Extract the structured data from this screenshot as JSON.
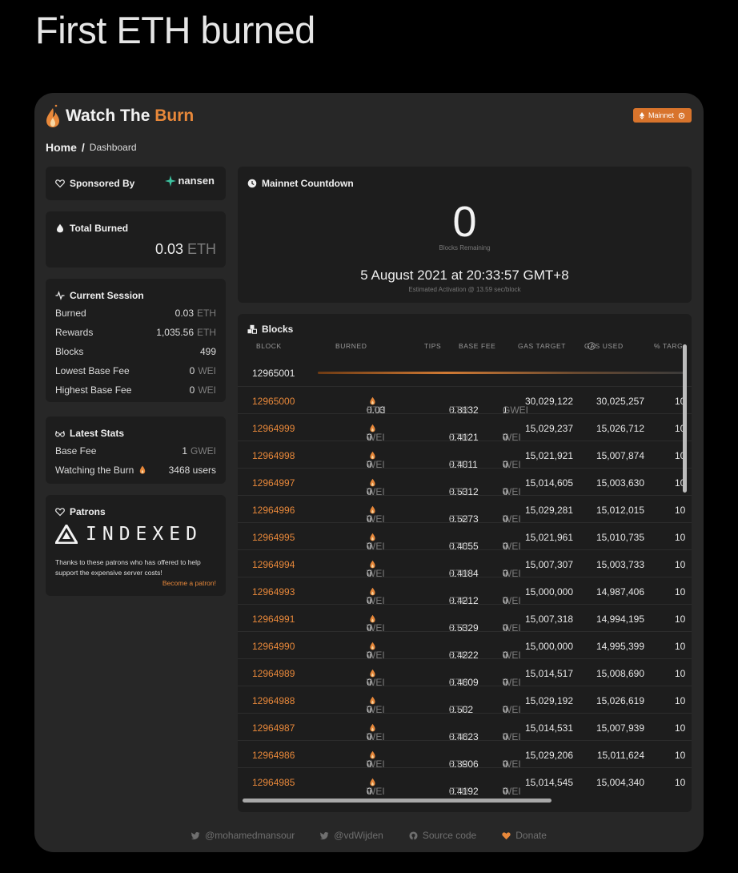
{
  "headline": "First ETH burned",
  "app": {
    "title_main": "Watch The",
    "title_accent": "Burn",
    "network_label": "Mainnet"
  },
  "breadcrumb": {
    "home": "Home",
    "sep": "/",
    "current": "Dashboard"
  },
  "sponsor": {
    "title": "Sponsored By",
    "logo_text": "nansen"
  },
  "total_burned": {
    "title": "Total Burned",
    "value": "0.03",
    "unit": "ETH"
  },
  "session": {
    "title": "Current Session",
    "rows": [
      {
        "label": "Burned",
        "value": "0.03",
        "unit": "ETH"
      },
      {
        "label": "Rewards",
        "value": "1,035.56",
        "unit": "ETH"
      },
      {
        "label": "Blocks",
        "value": "499",
        "unit": ""
      },
      {
        "label": "Lowest Base Fee",
        "value": "0",
        "unit": "WEI"
      },
      {
        "label": "Highest Base Fee",
        "value": "0",
        "unit": "WEI"
      }
    ]
  },
  "latest": {
    "title": "Latest Stats",
    "rows": [
      {
        "label": "Base Fee",
        "value": "1",
        "unit": "GWEI"
      },
      {
        "label": "Watching the Burn",
        "value": "3468 users",
        "unit": ""
      }
    ]
  },
  "patrons": {
    "title": "Patrons",
    "logo_text": "INDEXED",
    "note": "Thanks to these patrons who has offered to help support the expensive server costs!",
    "link": "Become a patron!"
  },
  "countdown": {
    "title": "Mainnet Countdown",
    "value": "0",
    "sub": "Blocks Remaining",
    "date": "5 August 2021 at 20:33:57 GMT+8",
    "estimate": "Estimated Activation @ 13.59 sec/block"
  },
  "blocks": {
    "title": "Blocks",
    "headers": [
      "BLOCK",
      "BURNED",
      "TIPS",
      "BASE FEE",
      "GAS TARGET",
      "GAS USED",
      "% TARG"
    ],
    "pending_block": "12965001",
    "rows": [
      {
        "block": "12965000",
        "burned": "0.03",
        "burned_unit": "ETH",
        "tips": "0.8132",
        "tips_unit": "ETH",
        "base": "1",
        "base_unit": "GWEI",
        "target": "30,029,122",
        "used": "30,025,257",
        "pct": "10"
      },
      {
        "block": "12964999",
        "burned": "0",
        "burned_unit": "WEI",
        "tips": "0.4121",
        "tips_unit": "ETH",
        "base": "0",
        "base_unit": "WEI",
        "target": "15,029,237",
        "used": "15,026,712",
        "pct": "10"
      },
      {
        "block": "12964998",
        "burned": "0",
        "burned_unit": "WEI",
        "tips": "0.4011",
        "tips_unit": "ETH",
        "base": "0",
        "base_unit": "WEI",
        "target": "15,021,921",
        "used": "15,007,874",
        "pct": "10"
      },
      {
        "block": "12964997",
        "burned": "0",
        "burned_unit": "WEI",
        "tips": "0.5312",
        "tips_unit": "ETH",
        "base": "0",
        "base_unit": "WEI",
        "target": "15,014,605",
        "used": "15,003,630",
        "pct": "10"
      },
      {
        "block": "12964996",
        "burned": "0",
        "burned_unit": "WEI",
        "tips": "0.5273",
        "tips_unit": "ETH",
        "base": "0",
        "base_unit": "WEI",
        "target": "15,029,281",
        "used": "15,012,015",
        "pct": "10"
      },
      {
        "block": "12964995",
        "burned": "0",
        "burned_unit": "WEI",
        "tips": "0.4055",
        "tips_unit": "ETH",
        "base": "0",
        "base_unit": "WEI",
        "target": "15,021,961",
        "used": "15,010,735",
        "pct": "10"
      },
      {
        "block": "12964994",
        "burned": "0",
        "burned_unit": "WEI",
        "tips": "0.4184",
        "tips_unit": "ETH",
        "base": "0",
        "base_unit": "WEI",
        "target": "15,007,307",
        "used": "15,003,733",
        "pct": "10"
      },
      {
        "block": "12964993",
        "burned": "0",
        "burned_unit": "WEI",
        "tips": "0.4212",
        "tips_unit": "ETH",
        "base": "0",
        "base_unit": "WEI",
        "target": "15,000,000",
        "used": "14,987,406",
        "pct": "10"
      },
      {
        "block": "12964991",
        "burned": "0",
        "burned_unit": "WEI",
        "tips": "0.5329",
        "tips_unit": "ETH",
        "base": "0",
        "base_unit": "WEI",
        "target": "15,007,318",
        "used": "14,994,195",
        "pct": "10"
      },
      {
        "block": "12964990",
        "burned": "0",
        "burned_unit": "WEI",
        "tips": "0.4222",
        "tips_unit": "ETH",
        "base": "0",
        "base_unit": "WEI",
        "target": "15,000,000",
        "used": "14,995,399",
        "pct": "10"
      },
      {
        "block": "12964989",
        "burned": "0",
        "burned_unit": "WEI",
        "tips": "0.4609",
        "tips_unit": "ETH",
        "base": "0",
        "base_unit": "WEI",
        "target": "15,014,517",
        "used": "15,008,690",
        "pct": "10"
      },
      {
        "block": "12964988",
        "burned": "0",
        "burned_unit": "WEI",
        "tips": "0.502",
        "tips_unit": "ETH",
        "base": "0",
        "base_unit": "WEI",
        "target": "15,029,192",
        "used": "15,026,619",
        "pct": "10"
      },
      {
        "block": "12964987",
        "burned": "0",
        "burned_unit": "WEI",
        "tips": "0.4623",
        "tips_unit": "ETH",
        "base": "0",
        "base_unit": "WEI",
        "target": "15,014,531",
        "used": "15,007,939",
        "pct": "10"
      },
      {
        "block": "12964986",
        "burned": "0",
        "burned_unit": "WEI",
        "tips": "0.3906",
        "tips_unit": "ETH",
        "base": "0",
        "base_unit": "WEI",
        "target": "15,029,206",
        "used": "15,011,624",
        "pct": "10"
      },
      {
        "block": "12964985",
        "burned": "0",
        "burned_unit": "WEI",
        "tips": "0.4192",
        "tips_unit": "ETH",
        "base": "0",
        "base_unit": "WEI",
        "target": "15,014,545",
        "used": "15,004,340",
        "pct": "10"
      }
    ]
  },
  "footer": {
    "twitter1": "@mohamedmansour",
    "twitter2": "@vdWijden",
    "source": "Source code",
    "donate": "Donate"
  },
  "colors": {
    "accent": "#e8883a",
    "button": "#d8742c",
    "card": "#1d1d1d",
    "panel": "#272727"
  }
}
